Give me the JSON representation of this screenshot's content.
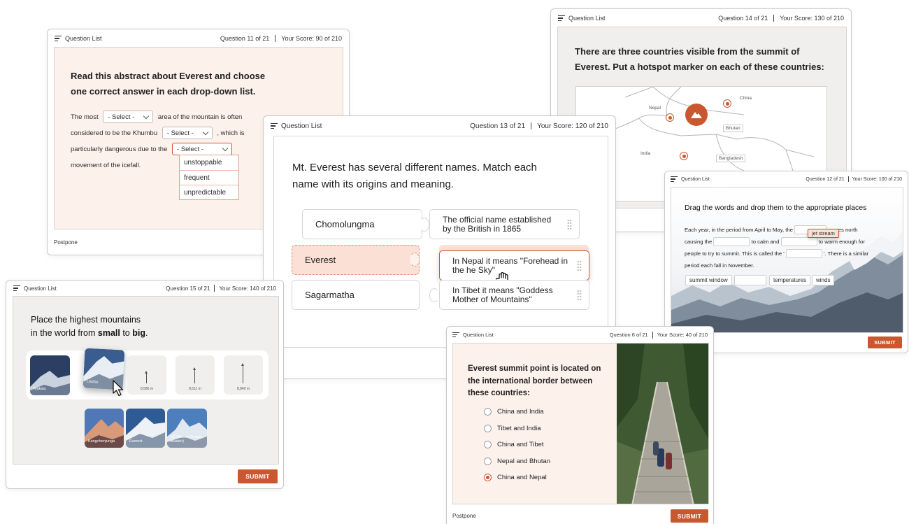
{
  "common": {
    "question_list": "Question List",
    "postpone": "Postpone",
    "submit": "SUBMIT"
  },
  "card_q11": {
    "progress": "Question 11 of 21",
    "score": "Your Score: 90 of 210",
    "question": "Read this abstract about Everest and choose one correct answer in each drop-down list.",
    "text": [
      "The most",
      "area of the mountain is often",
      "considered to be the Khumbu",
      ", which is",
      "particularly dangerous due to the",
      "movement of the icefall."
    ],
    "select_placeholder": "- Select -",
    "options": [
      "unstoppable",
      "frequent",
      "unpredictable"
    ]
  },
  "card_q14": {
    "progress": "Question 14 of 21",
    "score": "Your Score: 130 of 210",
    "question": "There are three countries visible from the summit of Everest. Put a hotspot marker on each of these countries:",
    "map_labels": [
      "Nepal",
      "China",
      "Bhutan",
      "India",
      "Bangladesh"
    ]
  },
  "card_q13": {
    "progress": "Question 13 of 21",
    "score": "Your Score: 120 of 210",
    "question": "Mt. Everest has several different names. Match each name with its origins and meaning.",
    "names": [
      "Chomolungma",
      "Everest",
      "Sagarmatha"
    ],
    "meanings": [
      "The official name established by the British in 1865",
      "In Nepal it means \"Forehead in the he Sky\"",
      "In Tibet it means \"Goddess Mother of Mountains\""
    ]
  },
  "card_q12": {
    "progress": "Question 12 of 21",
    "score": "Your Score: 100 of 210",
    "question": "Drag the words and drop them to the appropriate places",
    "text": [
      "Each year, in the period from April to May, the",
      "moves north",
      "causing the",
      "to calm and",
      "to warm enough for",
      "people to try to summit. This is called the '",
      "'. There is a similar",
      "period each fall in November."
    ],
    "dragging": "jet stream",
    "words": [
      "summit window",
      "temperatures",
      "winds"
    ]
  },
  "card_q15": {
    "progress": "Question 15 of 21",
    "score": "Your Score: 140 of 210",
    "question_line1": "Place the highest mountains",
    "question_line2_pre": "in the world from ",
    "small": "small",
    "to": " to ",
    "big": "big",
    "period": ".",
    "placed": [
      "Makalu",
      "Lhotse"
    ],
    "heights": [
      "8,586 m",
      "8,611 m",
      "8,849 m"
    ],
    "choices": [
      "Kangchenjunga",
      "Everest",
      "K2 (Mount Godwin Austen)"
    ]
  },
  "card_q6": {
    "progress": "Question 6 of 21",
    "score": "Your Score: 40 of 210",
    "question": "Everest summit point is located on the international border between these countries:",
    "options": [
      "China and India",
      "Tibet and India",
      "China and Tibet",
      "Nepal and Bhutan",
      "China and Nepal"
    ],
    "selected": 4
  },
  "colors": {
    "accent": "#c95830",
    "peach": "#fdf1ec",
    "panel_gray": "#f0efed"
  }
}
